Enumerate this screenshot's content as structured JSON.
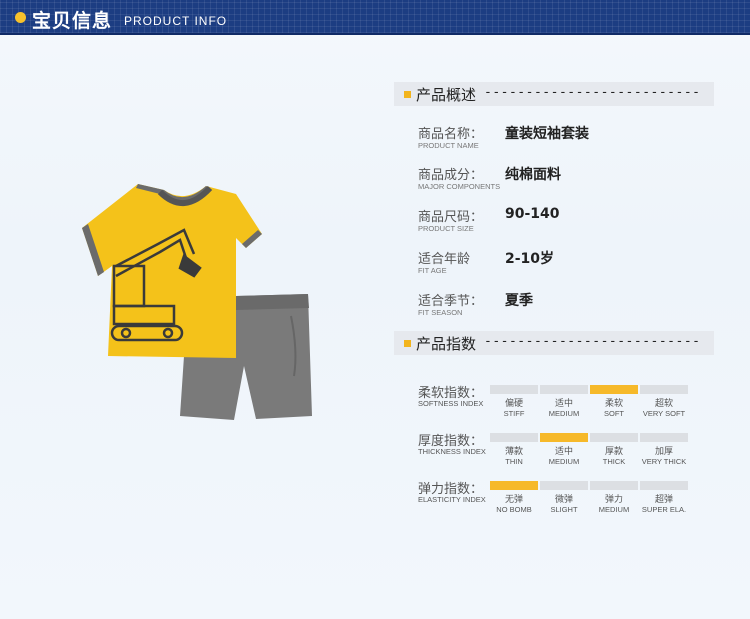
{
  "header": {
    "title_cn": "宝贝信息",
    "title_en": "PRODUCT INFO"
  },
  "colors": {
    "header_bg": "#1c3d82",
    "accent": "#f6b92a",
    "bar_inactive": "#dcdfe3"
  },
  "overview": {
    "heading": "产品概述",
    "dashes": "--------------------------",
    "rows": [
      {
        "label_cn": "商品名称：",
        "label_en": "PRODUCT NAME",
        "value": "童装短袖套装"
      },
      {
        "label_cn": "商品成分：",
        "label_en": "MAJOR COMPONENTS",
        "value": "纯棉面料"
      },
      {
        "label_cn": "商品尺码：",
        "label_en": "PRODUCT SIZE",
        "value": "90-140"
      },
      {
        "label_cn": "适合年龄",
        "label_en": "FIT AGE",
        "value": "2-10岁"
      },
      {
        "label_cn": "适合季节：",
        "label_en": "FIT SEASON",
        "value": "夏季"
      }
    ]
  },
  "indices": {
    "heading": "产品指数",
    "dashes": "--------------------------",
    "rows": [
      {
        "label_cn": "柔软指数：",
        "label_en": "SOFTNESS INDEX",
        "active": 2,
        "options": [
          {
            "cn": "偏硬",
            "en": "STIFF"
          },
          {
            "cn": "适中",
            "en": "MEDIUM"
          },
          {
            "cn": "柔软",
            "en": "SOFT"
          },
          {
            "cn": "超软",
            "en": "VERY SOFT"
          }
        ]
      },
      {
        "label_cn": "厚度指数：",
        "label_en": "THICKNESS INDEX",
        "active": 1,
        "options": [
          {
            "cn": "薄款",
            "en": "THIN"
          },
          {
            "cn": "适中",
            "en": "MEDIUM"
          },
          {
            "cn": "厚款",
            "en": "THICK"
          },
          {
            "cn": "加厚",
            "en": "VERY THICK"
          }
        ]
      },
      {
        "label_cn": "弹力指数：",
        "label_en": "ELASTICITY INDEX",
        "active": 0,
        "options": [
          {
            "cn": "无弹",
            "en": "NO BOMB"
          },
          {
            "cn": "微弹",
            "en": "SLIGHT"
          },
          {
            "cn": "弹力",
            "en": "MEDIUM"
          },
          {
            "cn": "超弹",
            "en": "SUPER ELA."
          }
        ]
      }
    ]
  },
  "product_image": {
    "icon": "tshirt-shorts-set-image"
  }
}
